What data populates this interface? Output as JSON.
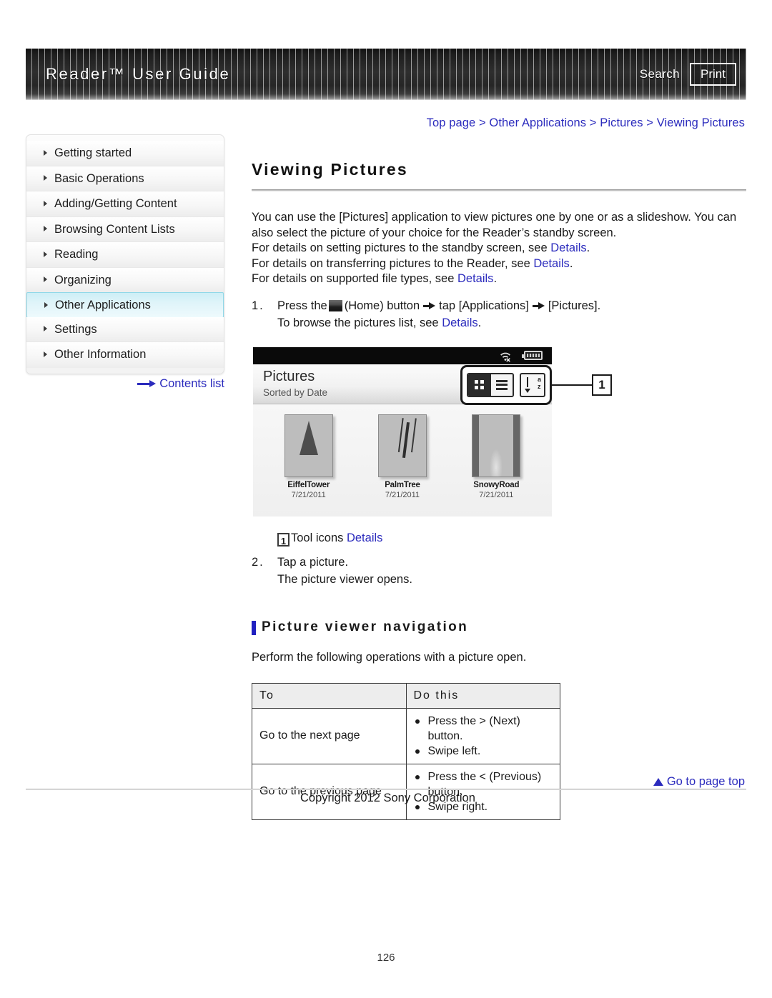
{
  "header": {
    "title": "Reader™ User Guide",
    "search_label": "Search",
    "print_label": "Print"
  },
  "breadcrumb": {
    "full": "Top page > Other Applications > Pictures > Viewing Pictures",
    "items": [
      "Top page",
      "Other Applications",
      "Pictures",
      "Viewing Pictures"
    ]
  },
  "sidebar": {
    "items": [
      {
        "label": "Getting started",
        "active": false
      },
      {
        "label": "Basic Operations",
        "active": false
      },
      {
        "label": "Adding/Getting Content",
        "active": false
      },
      {
        "label": "Browsing Content Lists",
        "active": false
      },
      {
        "label": "Reading",
        "active": false
      },
      {
        "label": "Organizing",
        "active": false
      },
      {
        "label": "Other Applications",
        "active": true
      },
      {
        "label": "Settings",
        "active": false
      },
      {
        "label": "Other Information",
        "active": false
      }
    ],
    "contents_link": "Contents list"
  },
  "main": {
    "page_title": "Viewing Pictures",
    "intro_line1": "You can use the [Pictures] application to view pictures one by one or as a slideshow. You can",
    "intro_line2": "also select the picture of your choice for the Reader’s standby screen.",
    "detail_line_1_pre": "For details on setting pictures to the standby screen, see ",
    "detail_line_1_link": "Details",
    "detail_line_1_post": ".",
    "detail_line_2_pre": "For details on transferring pictures to the Reader, see ",
    "detail_line_2_link": "Details",
    "detail_line_2_post": ".",
    "detail_line_3_pre": "For details on supported file types, see ",
    "detail_line_3_link": "Details",
    "detail_line_3_post": ".",
    "step1": {
      "num": "1.",
      "part_a": "Press the",
      "part_b": "(Home) button",
      "part_c": "tap [Applications]",
      "part_d": "[Pictures].",
      "sub_pre": "To browse the pictures list, see ",
      "sub_link": "Details",
      "sub_post": "."
    },
    "legend": {
      "marker": "1",
      "text": "Tool icons ",
      "link": "Details"
    },
    "step2": {
      "num": "2.",
      "text": "Tap a picture.",
      "sub": "The picture viewer opens."
    },
    "subhead": "Picture viewer navigation",
    "subpara": "Perform the following operations with a picture open."
  },
  "device_screenshot": {
    "app_title": "Pictures",
    "sort_label": "Sorted by Date",
    "callout_number": "1",
    "toolbar_icons": [
      "grid-view-icon",
      "list-view-icon",
      "sort-az-icon"
    ],
    "status_icons": [
      "wifi-off-icon",
      "battery-icon"
    ],
    "thumbnails": [
      {
        "name": "EiffelTower",
        "date": "7/21/2011"
      },
      {
        "name": "PalmTree",
        "date": "7/21/2011"
      },
      {
        "name": "SnowyRoad",
        "date": "7/21/2011"
      }
    ]
  },
  "table": {
    "headers": [
      "To",
      "Do this"
    ],
    "rows": [
      {
        "to": "Go to the next page",
        "do": [
          "Press the > (Next) button.",
          "Swipe left."
        ]
      },
      {
        "to": "Go to the previous page",
        "do": [
          "Press the < (Previous) button.",
          "Swipe right."
        ]
      }
    ]
  },
  "footer": {
    "go_to_top": "Go to page top",
    "copyright": "Copyright 2012 Sony Corporation",
    "page_number": "126"
  },
  "colors": {
    "link": "#2b2bbd",
    "accent_bar": "#2020c0",
    "sidebar_active_border": "#8fd8e8",
    "header_bg": "#222222"
  }
}
